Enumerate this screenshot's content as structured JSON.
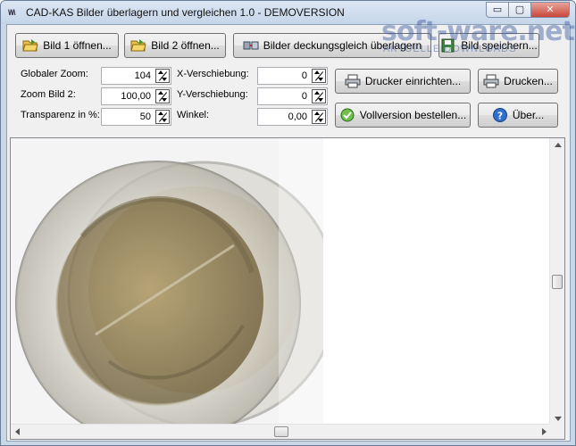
{
  "window": {
    "title": "CAD-KAS Bilder überlagern und vergleichen 1.0 - DEMOVERSION",
    "app_icon_text": "\\/\\/\\",
    "min_glyph": "▭",
    "max_glyph": "▢",
    "close_glyph": "✕"
  },
  "toolbar": {
    "open1_label": "Bild 1 öffnen...",
    "open2_label": "Bild 2 öffnen...",
    "align_label": "Bilder deckungsgleich überlagern",
    "save_label": "Bild speichern...",
    "printer_setup_label": "Drucker einrichten...",
    "print_label": "Drucken...",
    "order_label": "Vollversion bestellen...",
    "about_label": "Über..."
  },
  "params": {
    "global_zoom": {
      "label": "Globaler Zoom:",
      "value": "104"
    },
    "zoom_image2": {
      "label": "Zoom Bild 2:",
      "value": "100,00"
    },
    "transparency": {
      "label": "Transparenz in %:",
      "value": "50"
    },
    "x_shift": {
      "label": "X-Verschiebung:",
      "value": "0"
    },
    "y_shift": {
      "label": "Y-Verschiebung:",
      "value": "0"
    },
    "angle": {
      "label": "Winkel:",
      "value": "0,00"
    }
  },
  "watermark": {
    "main": "soft-ware.net",
    "sub": "AKTUELLE DOWNLOADS"
  },
  "colors": {
    "coin_ring": "#b9b6a8",
    "coin_core": "#8c7a4e",
    "accent": "#2b5aa8"
  },
  "scroll": {
    "vertical_position": 0.5,
    "horizontal_position": 0.5
  }
}
